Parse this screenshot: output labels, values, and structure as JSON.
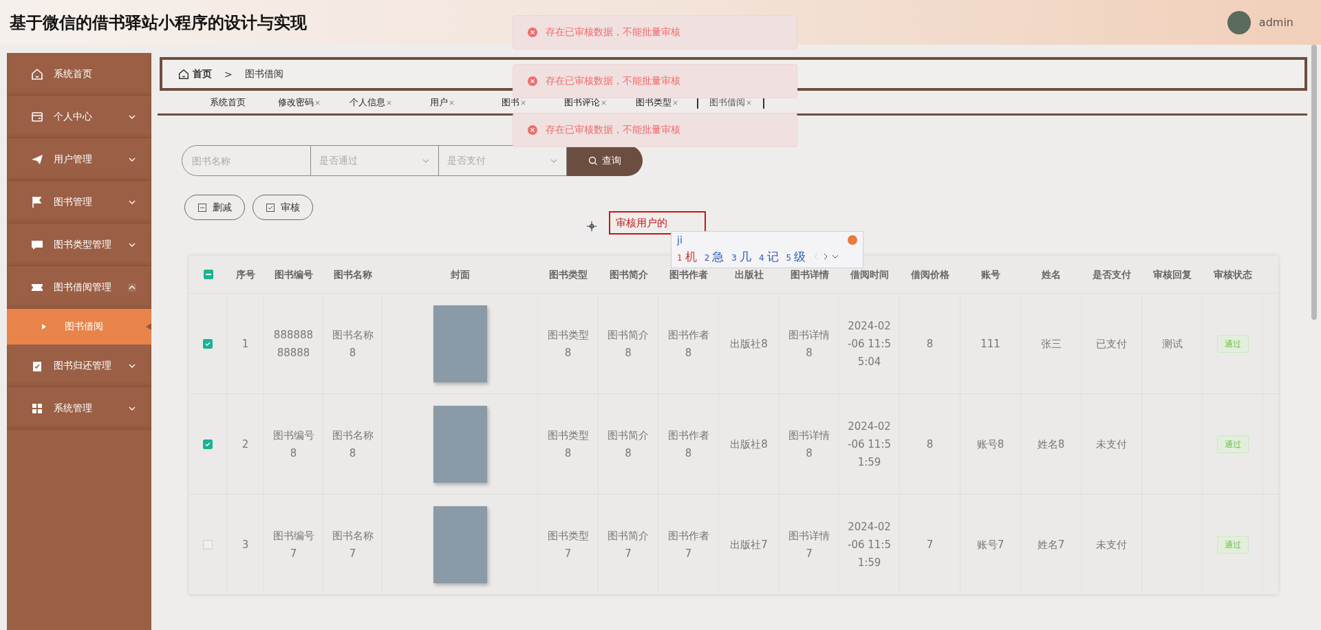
{
  "header": {
    "title": "基于微信的借书驿站小程序的设计与实现",
    "user": "admin"
  },
  "sidebar": {
    "items": [
      {
        "label": "系统首页",
        "kind": "link"
      },
      {
        "label": "个人中心",
        "kind": "menu",
        "expanded": false
      },
      {
        "label": "用户管理",
        "kind": "menu",
        "expanded": false
      },
      {
        "label": "图书管理",
        "kind": "menu",
        "expanded": false
      },
      {
        "label": "图书类型管理",
        "kind": "menu",
        "expanded": false
      },
      {
        "label": "图书借阅管理",
        "kind": "menu",
        "expanded": true,
        "children": [
          {
            "label": "图书借阅",
            "selected": true
          }
        ]
      },
      {
        "label": "图书归还管理",
        "kind": "menu",
        "expanded": false
      },
      {
        "label": "系统管理",
        "kind": "menu",
        "expanded": false
      }
    ]
  },
  "breadcrumb": [
    "首页",
    "图书借阅"
  ],
  "breadcrumb_separator": ">",
  "tabs": [
    {
      "label": "系统首页",
      "closable": false,
      "selected": false
    },
    {
      "label": "修改密码",
      "closable": true,
      "selected": false
    },
    {
      "label": "个人信息",
      "closable": true,
      "selected": false
    },
    {
      "label": "用户",
      "closable": true,
      "selected": false
    },
    {
      "label": "图书",
      "closable": true,
      "selected": false
    },
    {
      "label": "图书评论",
      "closable": true,
      "selected": false
    },
    {
      "label": "图书类型",
      "closable": true,
      "selected": false
    },
    {
      "label": "图书借阅",
      "closable": true,
      "selected": true
    }
  ],
  "search": {
    "name_placeholder": "图书名称",
    "passed_placeholder": "是否通过",
    "paid_placeholder": "是否支付",
    "button": "查询"
  },
  "actions": [
    "删减",
    "审核"
  ],
  "annotation": {
    "text": "审核用户的"
  },
  "ime": {
    "input": "ji",
    "candidates": [
      {
        "index": "1",
        "text": "机",
        "selected": true
      },
      {
        "index": "2",
        "text": "急",
        "selected": false
      },
      {
        "index": "3",
        "text": "几",
        "selected": false
      },
      {
        "index": "4",
        "text": "记",
        "selected": false
      },
      {
        "index": "5",
        "text": "级",
        "selected": false
      }
    ]
  },
  "toasts": [
    "存在已审核数据，不能批量审核",
    "存在已审核数据，不能批量审核",
    "存在已审核数据，不能批量审核"
  ],
  "table": {
    "select_all_indeterminate": true,
    "columns": [
      "序号",
      "图书编号",
      "图书名称",
      "封面",
      "图书类型",
      "图书简介",
      "图书作者",
      "出版社",
      "图书详情",
      "借阅时间",
      "借阅价格",
      "账号",
      "姓名",
      "是否支付",
      "审核回复",
      "审核状态"
    ],
    "rows": [
      {
        "checked": true,
        "cells": [
          "1",
          "88888888888",
          "图书名称8",
          null,
          "图书类型8",
          "图书简介8",
          "图书作者8",
          "出版社8",
          "图书详情8",
          "2024-02-06 11:55:04",
          "8",
          "111",
          "张三",
          "已支付",
          "测试",
          "通过"
        ]
      },
      {
        "checked": true,
        "cells": [
          "2",
          "图书编号8",
          "图书名称8",
          null,
          "图书类型8",
          "图书简介8",
          "图书作者8",
          "出版社8",
          "图书详情8",
          "2024-02-06 11:51:59",
          "8",
          "账号8",
          "姓名8",
          "未支付",
          "",
          "通过"
        ]
      },
      {
        "checked": false,
        "cells": [
          "3",
          "图书编号7",
          "图书名称7",
          null,
          "图书类型7",
          "图书简介7",
          "图书作者7",
          "出版社7",
          "图书详情7",
          "2024-02-06 11:51:59",
          "7",
          "账号7",
          "姓名7",
          "未支付",
          "",
          "通过"
        ]
      }
    ]
  }
}
